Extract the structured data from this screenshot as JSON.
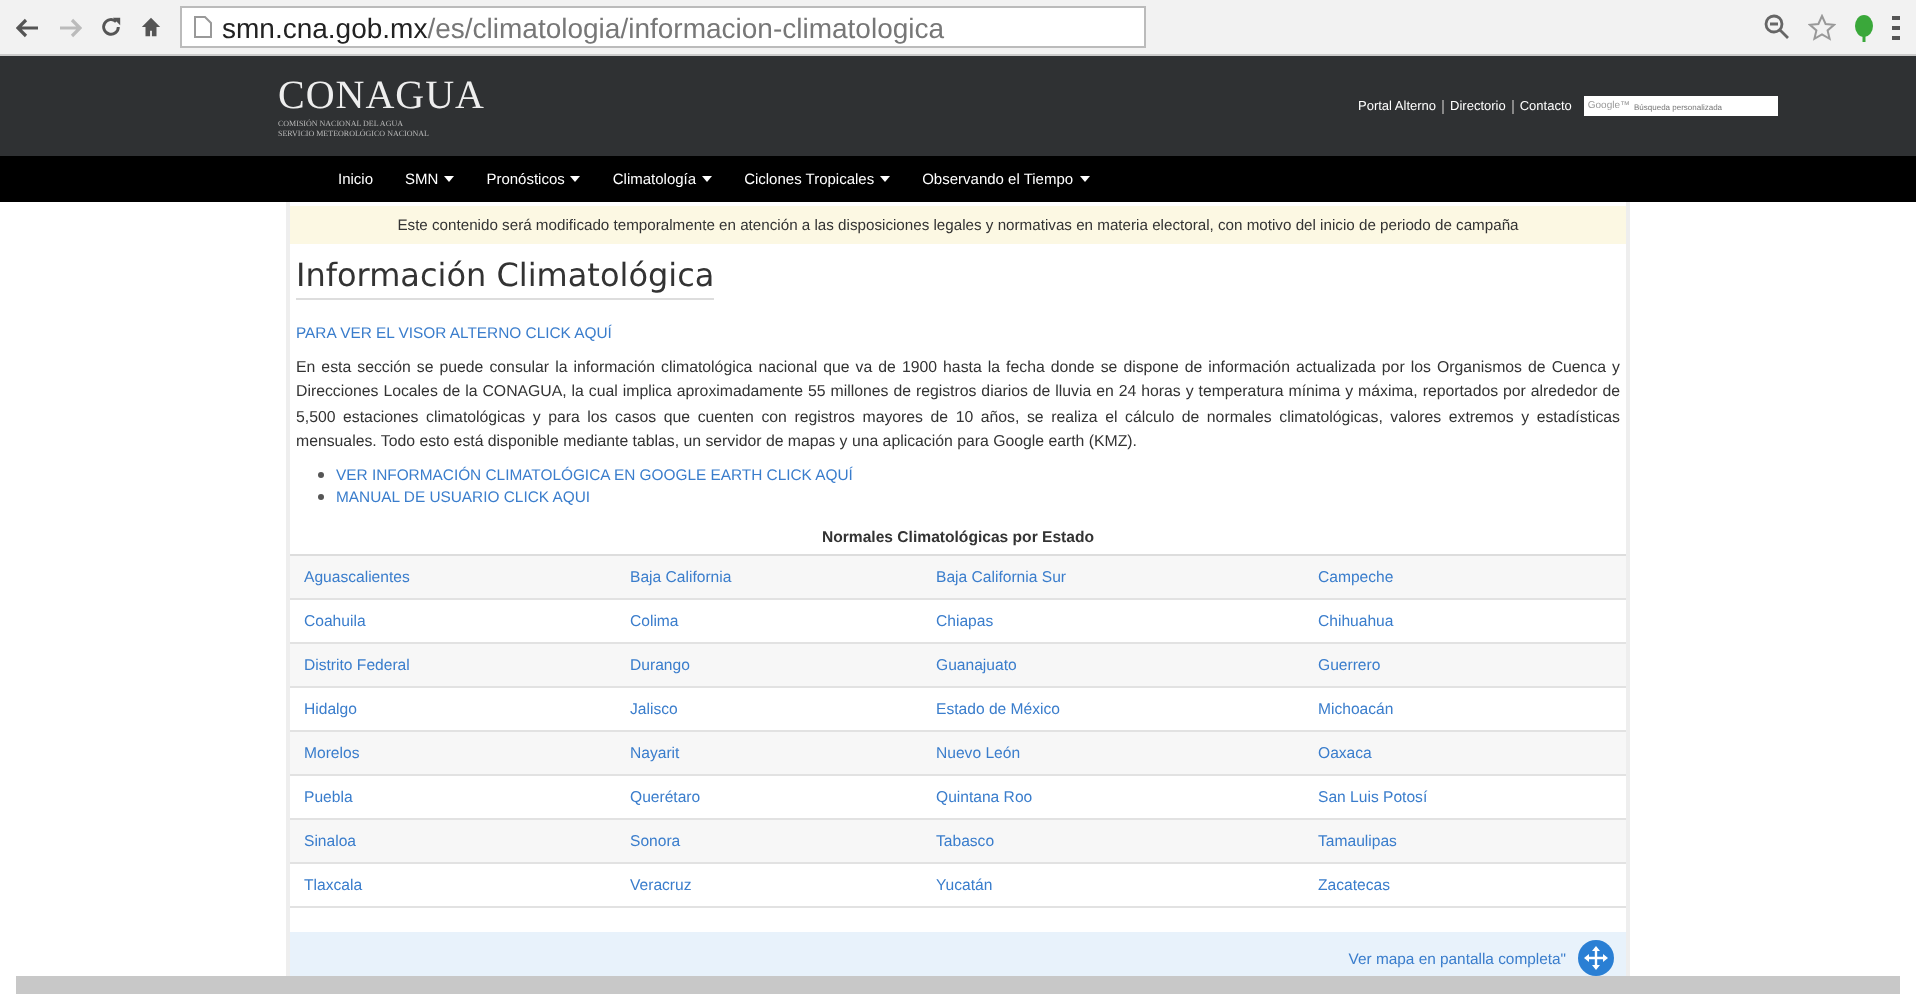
{
  "browser": {
    "url_host": "smn.cna.gob.mx",
    "url_path": "/es/climatologia/informacion-climatologica"
  },
  "header": {
    "logo": "CONAGUA",
    "logo_sub1": "COMISIÓN NACIONAL DEL AGUA",
    "logo_sub2": "SERVICIO METEOROLÓGICO NACIONAL",
    "links": [
      "Portal Alterno",
      "Directorio",
      "Contacto"
    ],
    "search": {
      "brand": "Google™",
      "placeholder": "Búsqueda personalizada"
    }
  },
  "nav": [
    {
      "label": "Inicio",
      "dropdown": false
    },
    {
      "label": "SMN",
      "dropdown": true
    },
    {
      "label": "Pronósticos",
      "dropdown": true
    },
    {
      "label": "Climatología",
      "dropdown": true
    },
    {
      "label": "Ciclones Tropicales",
      "dropdown": true
    },
    {
      "label": "Observando el Tiempo",
      "dropdown": true
    }
  ],
  "notice": "Este contenido será modificado temporalmente en atención a las disposiciones legales y normativas en materia electoral, con motivo del inicio de periodo de campaña",
  "title": "Información Climatológica",
  "alt_link": "PARA VER EL VISOR ALTERNO CLICK AQUÍ",
  "paragraph": "En esta sección se puede consular la información climatológica nacional que va de 1900 hasta la fecha donde se dispone de información actualizada por los Organismos de Cuenca y Direcciones Locales de la CONAGUA, la cual implica aproximadamente 55 millones de registros diarios de lluvia en 24 horas y temperatura mínima y máxima, reportados por alrededor de 5,500 estaciones climatológicas y para los casos que cuenten con registros mayores de 10 años, se realiza el cálculo de normales climatológicas, valores extremos y estadísticas mensuales. Todo esto está disponible mediante tablas, un servidor de mapas y una aplicación para Google earth (KMZ).",
  "bullets": [
    "VER INFORMACIÓN CLIMATOLÓGICA EN GOOGLE EARTH CLICK AQUÍ",
    "MANUAL DE USUARIO CLICK AQUI"
  ],
  "table": {
    "heading": "Normales Climatológicas por Estado",
    "rows": [
      [
        "Aguascalientes",
        "Baja California",
        "Baja California Sur",
        "Campeche"
      ],
      [
        "Coahuila",
        "Colima",
        "Chiapas",
        "Chihuahua"
      ],
      [
        "Distrito Federal",
        "Durango",
        "Guanajuato",
        "Guerrero"
      ],
      [
        "Hidalgo",
        "Jalisco",
        "Estado de México",
        "Michoacán"
      ],
      [
        "Morelos",
        "Nayarit",
        "Nuevo León",
        "Oaxaca"
      ],
      [
        "Puebla",
        "Querétaro",
        "Quintana Roo",
        "San Luis Potosí"
      ],
      [
        "Sinaloa",
        "Sonora",
        "Tabasco",
        "Tamaulipas"
      ],
      [
        "Tlaxcala",
        "Veracruz",
        "Yucatán",
        "Zacatecas"
      ]
    ]
  },
  "map_link": "Ver mapa en pantalla completa\""
}
